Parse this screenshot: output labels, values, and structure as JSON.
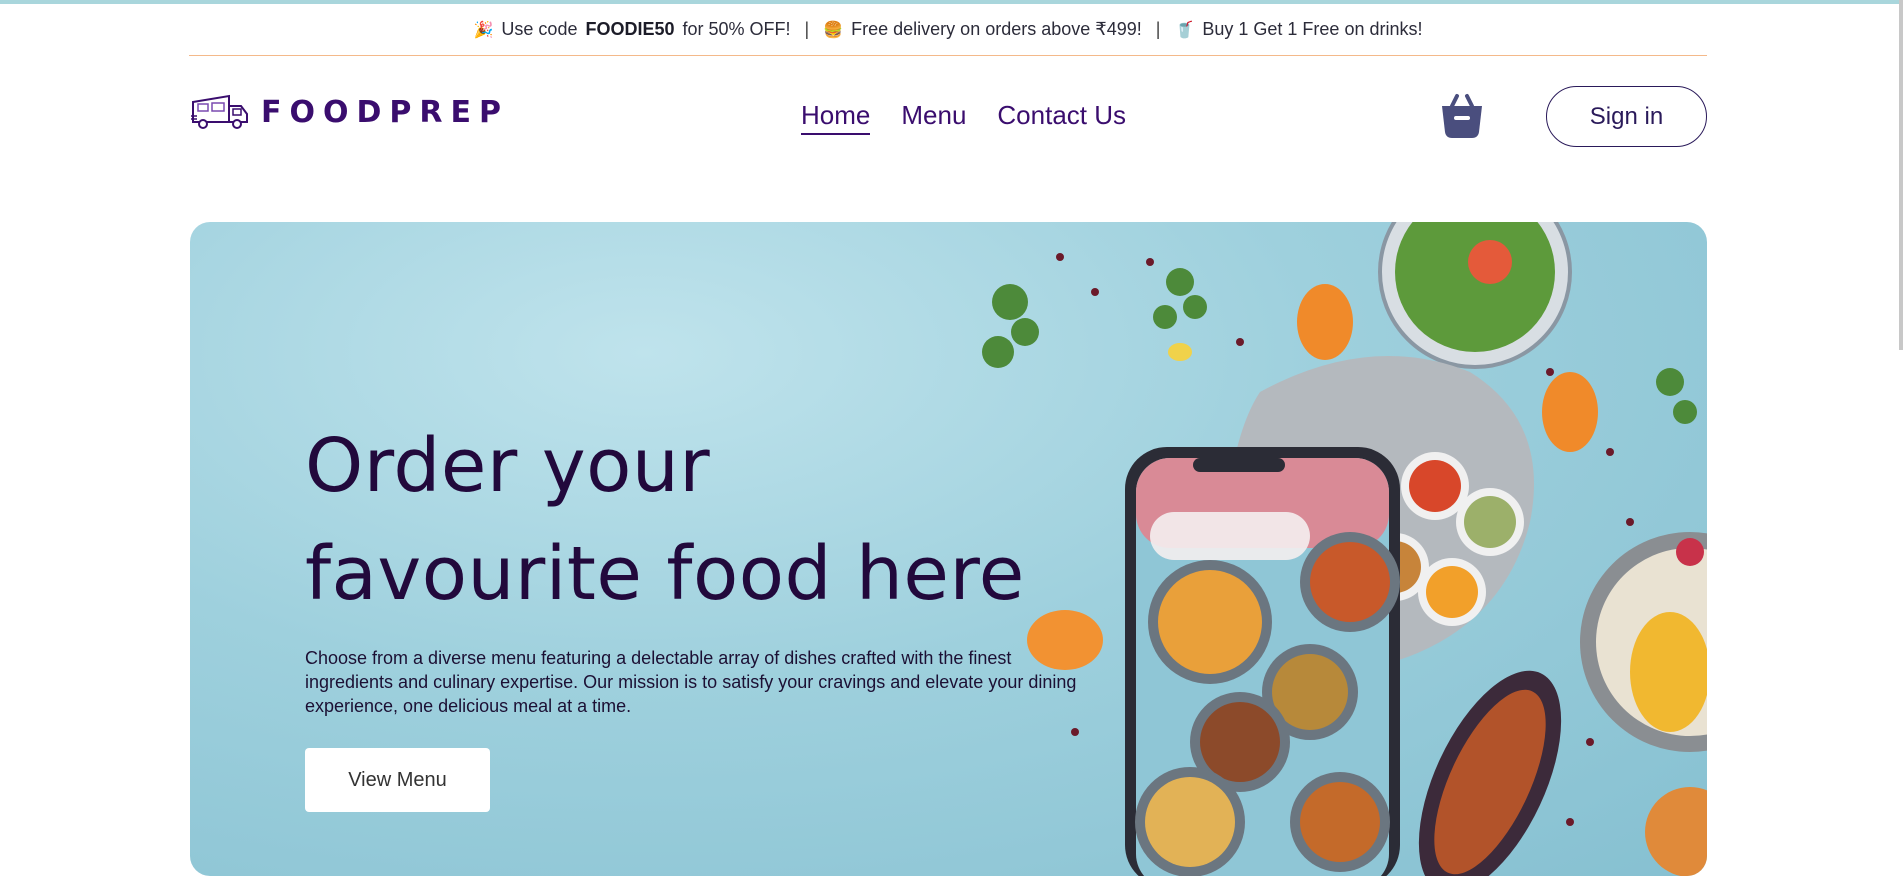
{
  "promo": {
    "item1_prefix": "Use code",
    "item1_code": "FOODIE50",
    "item1_suffix": "for 50% OFF!",
    "item2": "Free delivery on orders above ₹499!",
    "item3": "Buy 1 Get 1 Free on drinks!",
    "separator": "|",
    "icons": [
      "party-popper-icon",
      "burger-icon",
      "drink-cup-icon"
    ]
  },
  "brand": {
    "name": "FOODPREP",
    "logo_icon": "food-truck-icon",
    "color": "#3a0d6e"
  },
  "nav": {
    "items": [
      {
        "label": "Home",
        "active": true
      },
      {
        "label": "Menu",
        "active": false
      },
      {
        "label": "Contact Us",
        "active": false
      }
    ]
  },
  "header": {
    "cart_icon": "shopping-basket-icon",
    "signin_label": "Sign in"
  },
  "hero": {
    "title_line1": "Order your",
    "title_line2": "favourite food here",
    "description": "Choose from a diverse menu featuring a delectable array of dishes crafted with the finest ingredients and culinary expertise. Our mission is to satisfy your cravings and elevate your dining experience, one delicious meal at a time.",
    "cta_label": "View Menu",
    "background_color": "#9ed0dd"
  }
}
